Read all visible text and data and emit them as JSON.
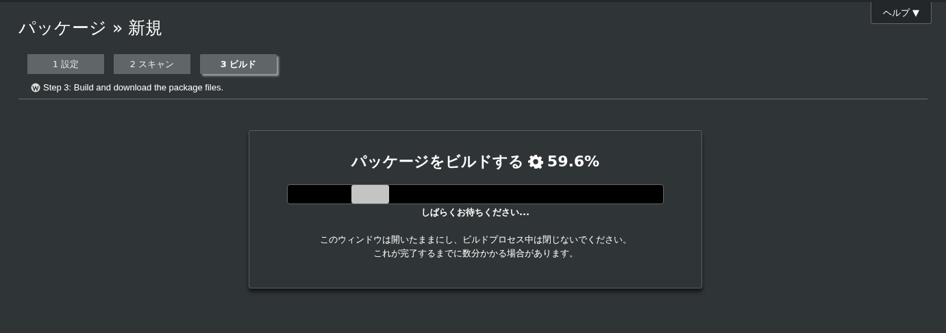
{
  "header": {
    "title": "パッケージ » 新規",
    "help_button": "ヘルプ ▼"
  },
  "steps": [
    {
      "label": "1 設定",
      "selected": false
    },
    {
      "label": "2 スキャン",
      "selected": false
    },
    {
      "label": "3 ビルド",
      "selected": true
    }
  ],
  "step_hint": "Step 3: Build and download the package files.",
  "build_card": {
    "title": "パッケージをビルドする",
    "percent": "59.6%",
    "status": "しばらくお待ちください...",
    "message_lines": [
      "このウィンドウは開いたままにし、ビルドプロセス中は閉じないでください。",
      "これが完了するまでに数分かかる場合があります。"
    ]
  }
}
